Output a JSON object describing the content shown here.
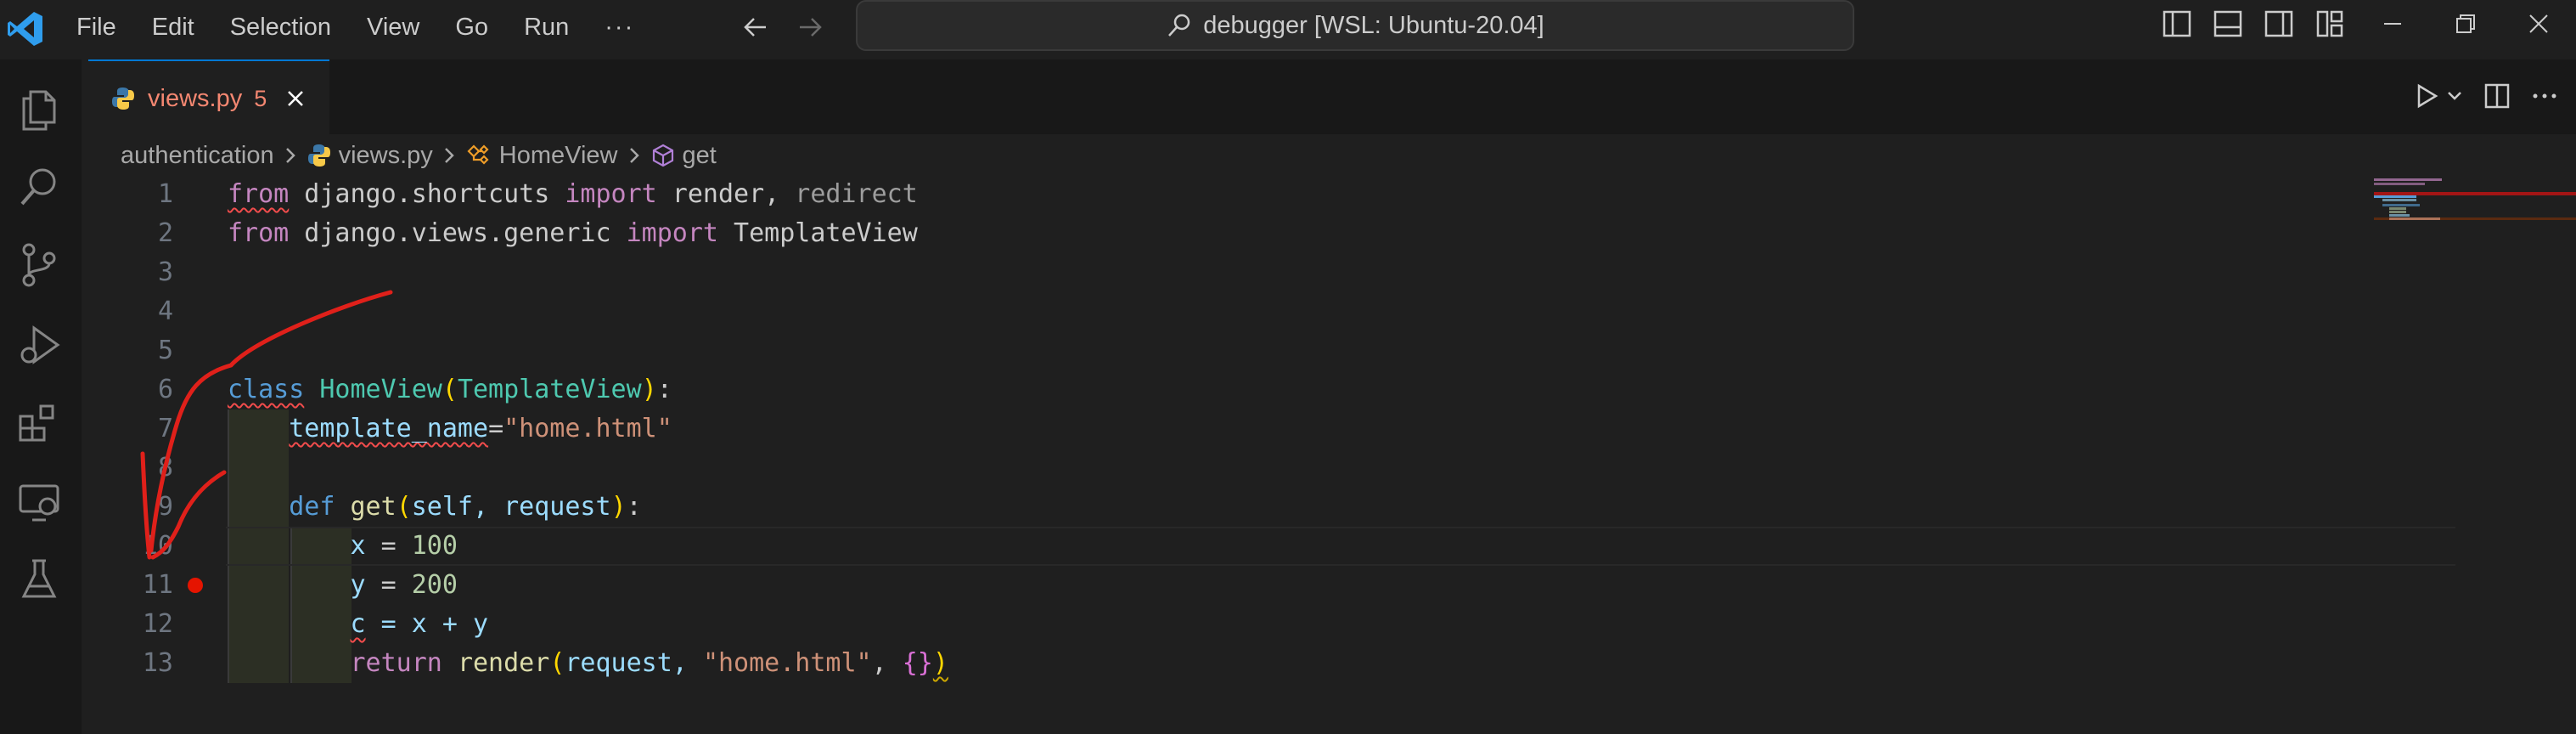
{
  "window": {
    "menu": [
      "File",
      "Edit",
      "Selection",
      "View",
      "Go",
      "Run"
    ],
    "more": "···",
    "title": "debugger [WSL: Ubuntu-20.04]"
  },
  "tab": {
    "name": "views.py",
    "problems": "5"
  },
  "breadcrumb": {
    "folder": "authentication",
    "file": "views.py",
    "class": "HomeView",
    "method": "get"
  },
  "code": {
    "line_numbers": [
      "1",
      "2",
      "3",
      "4",
      "5",
      "6",
      "7",
      "8",
      "9",
      "10",
      "11",
      "12",
      "13"
    ],
    "l1": {
      "from": "from",
      "mod": " django.shortcuts ",
      "import": "import",
      "rest": " render, ",
      "dim": "redirect"
    },
    "l2": {
      "from": "from",
      "mod": " django.views.generic ",
      "import": "import",
      "rest": " TemplateView"
    },
    "l6": {
      "kw": "class",
      "name": "HomeView",
      "open": "(",
      "base": "TemplateView",
      "close": ")",
      "colon": ":"
    },
    "l7": {
      "var": "template_name",
      "eq": "=",
      "str": "\"home.html\""
    },
    "l9": {
      "kw": "def",
      "name": "get",
      "open": "(",
      "params": "self, request",
      "close": ")",
      "colon": ":"
    },
    "l10": {
      "var": "x",
      "eq": " = ",
      "num": "100"
    },
    "l11": {
      "var": "y",
      "eq": " = ",
      "num": "200"
    },
    "l12": {
      "var": "c",
      "rest": " = x + y"
    },
    "l13": {
      "kw": "return",
      "fn": "render",
      "open": "(",
      "arg1": "request, ",
      "str": "\"home.html\"",
      "comma": ", ",
      "obj": "{}",
      "close": ")"
    },
    "breakpoint_line": "11"
  },
  "colors": {
    "accent": "#0078d4",
    "error": "#f14c4c",
    "breakpoint": "#e51400",
    "annotation": "#e0201a"
  }
}
